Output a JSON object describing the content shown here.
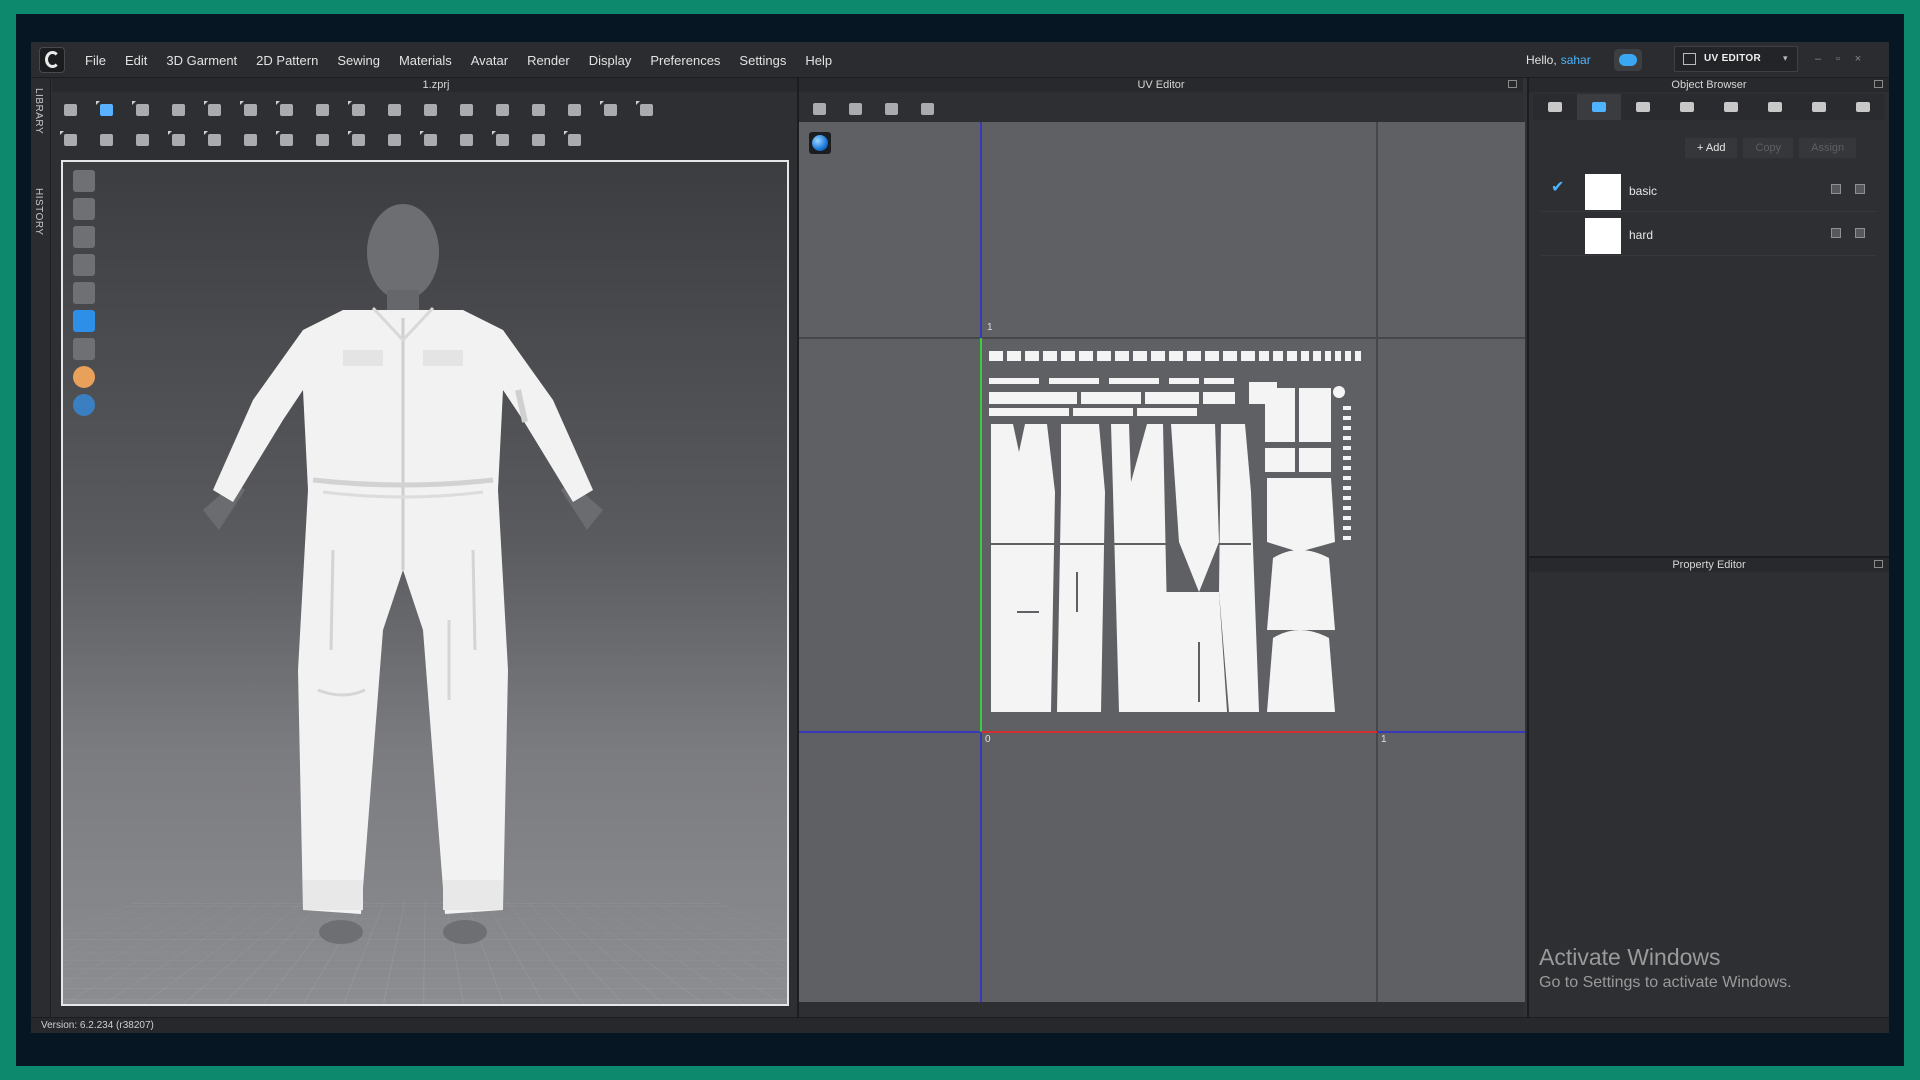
{
  "menubar": {
    "items": [
      "File",
      "Edit",
      "3D Garment",
      "2D Pattern",
      "Sewing",
      "Materials",
      "Avatar",
      "Render",
      "Display",
      "Preferences",
      "Settings",
      "Help"
    ],
    "hello": "Hello,",
    "username": "sahar",
    "mode": "UV EDITOR",
    "mode_arrow": "▾"
  },
  "left_tabs": {
    "library": "LIBRARY",
    "history": "HISTORY"
  },
  "viewport3d": {
    "title": "1.zprj"
  },
  "uv_editor": {
    "title": "UV Editor",
    "axis_labels": {
      "top_left": "1",
      "origin": "0",
      "right": "1"
    }
  },
  "object_browser": {
    "title": "Object Browser",
    "actions": {
      "add": "+ Add",
      "copy": "Copy",
      "assign": "Assign"
    },
    "materials": [
      {
        "name": "basic",
        "selected": true,
        "swatch_color": "#ffffff"
      },
      {
        "name": "hard",
        "selected": false,
        "swatch_color": "#ffffff"
      }
    ]
  },
  "property_editor": {
    "title": "Property Editor",
    "watermark_title": "Activate Windows",
    "watermark_subtitle": "Go to Settings to activate Windows."
  },
  "status": {
    "version": "Version: 6.2.234 (r38207)"
  },
  "colors": {
    "accent": "#4fb4ff",
    "frame": "#0d8a6e",
    "u_axis": "#d23030",
    "v_axis": "#3ccc3c",
    "guide": "#2a2ad8"
  },
  "icons": [
    "cloud-icon",
    "uv-editor-icon",
    "sphere-preview-icon",
    "checkmark-icon"
  ]
}
